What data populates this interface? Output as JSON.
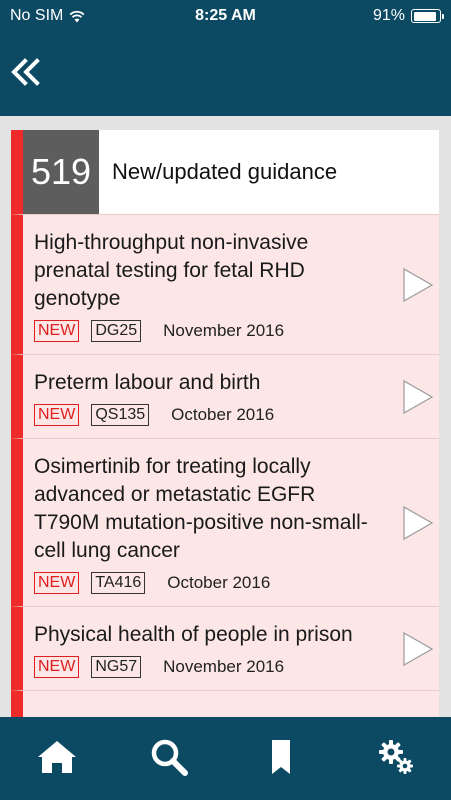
{
  "status_bar": {
    "carrier": "No SIM",
    "time": "8:25 AM",
    "battery": "91%",
    "battery_level": 0.91
  },
  "nav": {
    "back_icon": "double-chevron-left-icon"
  },
  "header": {
    "count": "519",
    "title": "New/updated guidance"
  },
  "items": [
    {
      "title": "High-throughput non-invasive prenatal testing for fetal RHD genotype",
      "badge": "NEW",
      "code": "DG25",
      "date": "November 2016"
    },
    {
      "title": "Preterm labour and birth",
      "badge": "NEW",
      "code": "QS135",
      "date": "October 2016"
    },
    {
      "title": "Osimertinib for treating locally advanced or metastatic EGFR T790M mutation-positive non-small-cell lung cancer",
      "badge": "NEW",
      "code": "TA416",
      "date": "October 2016"
    },
    {
      "title": "Physical health of people in prison",
      "badge": "NEW",
      "code": "NG57",
      "date": "November 2016"
    }
  ],
  "tab_bar": {
    "icons": [
      "home-icon",
      "search-icon",
      "bookmark-icon",
      "settings-icon"
    ]
  },
  "colors": {
    "navy": "#0c4a63",
    "accent_red": "#ee2a2a",
    "item_background": "#fce6e6",
    "count_box": "#5d5d5d"
  }
}
